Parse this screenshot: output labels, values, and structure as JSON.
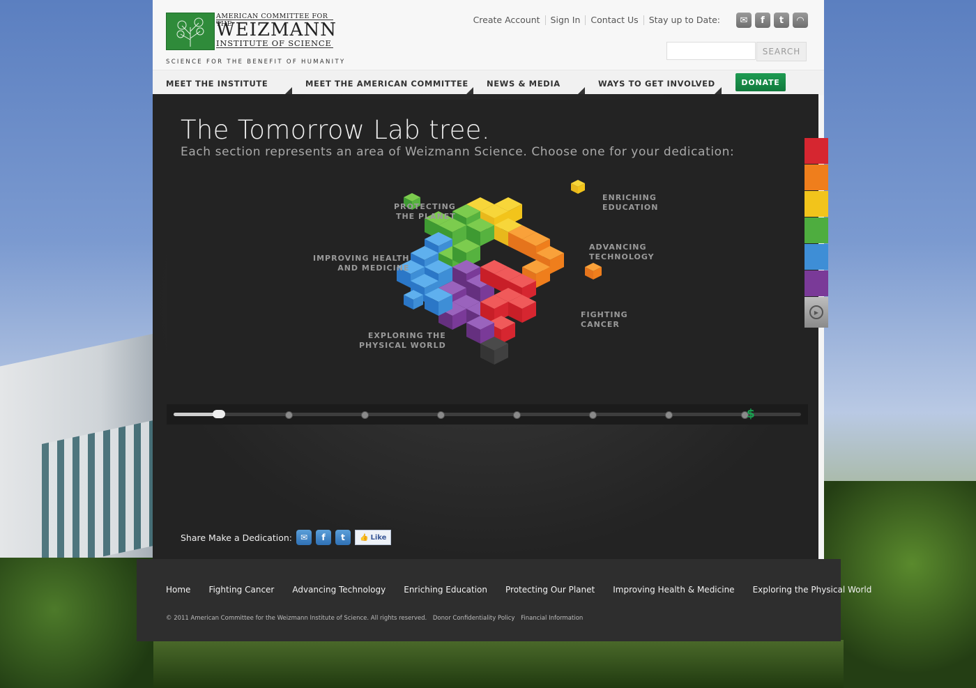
{
  "header": {
    "logo": {
      "line1": "AMERICAN COMMITTEE FOR THE",
      "line2": "WEIZMANN",
      "line3": "INSTITUTE OF SCIENCE",
      "tagline": "SCIENCE FOR THE BENEFIT OF HUMANITY"
    },
    "top_links": [
      "Create Account",
      "Sign In",
      "Contact Us",
      "Stay up to Date:"
    ],
    "social_icons": [
      "email-icon",
      "facebook-icon",
      "twitter-icon",
      "rss-icon"
    ],
    "search": {
      "placeholder": "",
      "button_label": "SEARCH"
    }
  },
  "nav": {
    "items": [
      "MEET THE INSTITUTE",
      "MEET THE AMERICAN COMMITTEE",
      "NEWS & MEDIA",
      "WAYS TO GET INVOLVED"
    ],
    "donate_label": "DONATE"
  },
  "stage": {
    "title": "The Tomorrow Lab tree.",
    "subtitle": "Each section represents an area of Weizmann Science. Choose one for your dedication:",
    "tree_labels": {
      "protecting": [
        "PROTECTING",
        "THE PLANET"
      ],
      "enriching": [
        "ENRICHING",
        "EDUCATION"
      ],
      "health": [
        "IMPROVING HEALTH",
        "AND MEDICINE"
      ],
      "technology": [
        "ADVANCING",
        "TECHNOLOGY"
      ],
      "cancer": [
        "FIGHTING",
        "CANCER"
      ],
      "physical": [
        "EXPLORING THE",
        "PHYSICAL WORLD"
      ]
    },
    "slider": {
      "steps": 9,
      "current_step": 1,
      "end_symbol": "$"
    },
    "share_label": "Share Make a Dedication:",
    "like_label": "Like"
  },
  "tabs": {
    "colors": [
      "#d62630",
      "#ef7e1c",
      "#f2c41b",
      "#4ead3f",
      "#3e8ed6",
      "#7a3a98"
    ]
  },
  "footer": {
    "links": [
      "Home",
      "Fighting Cancer",
      "Advancing Technology",
      "Enriching Education",
      "Protecting Our Planet",
      "Improving Health & Medicine",
      "Exploring the Physical World"
    ],
    "copyright": "© 2011 American Committee for the Weizmann Institute of Science. All rights reserved.",
    "legal_links": [
      "Donor Confidentiality Policy",
      "Financial Information"
    ]
  },
  "colors": {
    "brand_green": "#2f8b3a",
    "donate_green": "#1a8c48"
  }
}
